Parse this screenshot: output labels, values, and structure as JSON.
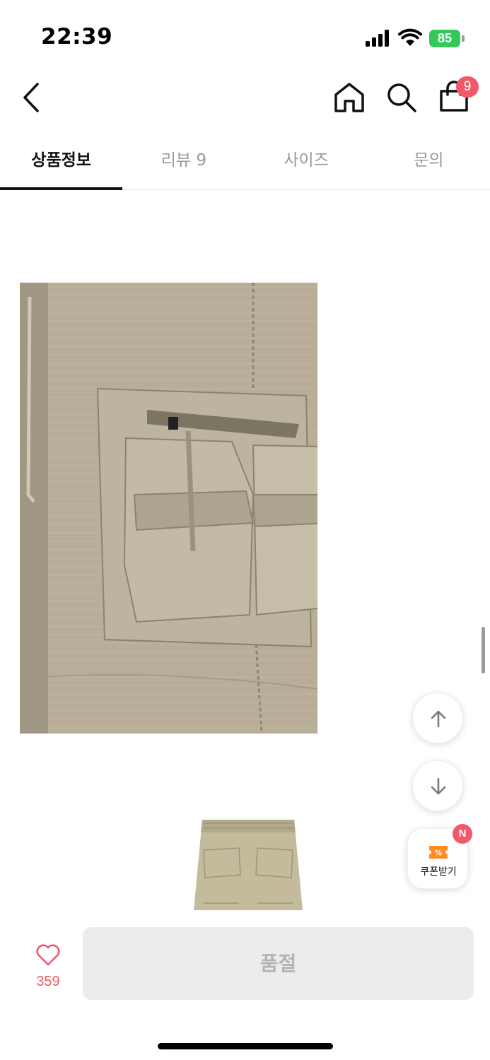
{
  "status_bar": {
    "time": "22:39",
    "battery": "85",
    "icons": [
      "signal-icon",
      "wifi-icon",
      "battery-icon"
    ]
  },
  "header": {
    "icons": [
      "back-arrow-icon",
      "home-icon",
      "search-icon",
      "shopping-bag-icon"
    ],
    "cart_count": "9"
  },
  "tabs": [
    {
      "label": "상품정보",
      "active": true
    },
    {
      "label": "리뷰 9",
      "active": false
    },
    {
      "label": "사이즈",
      "active": false
    },
    {
      "label": "문의",
      "active": false
    }
  ],
  "content": {
    "images": [
      "cargo-pants-pocket-closeup",
      "cargo-pants-back-view"
    ]
  },
  "floating": {
    "icons": [
      "arrow-up-icon",
      "arrow-down-icon",
      "coupon-icon"
    ],
    "coupon_label": "쿠폰받기",
    "coupon_badge": "N"
  },
  "bottom_bar": {
    "like_count": "359",
    "soldout_label": "품절"
  },
  "colors": {
    "accent": "#f05a68",
    "battery": "#34c759",
    "coupon": "#ff8a1f",
    "disabled_bg": "#ececec",
    "disabled_text": "#b3b3b3"
  }
}
